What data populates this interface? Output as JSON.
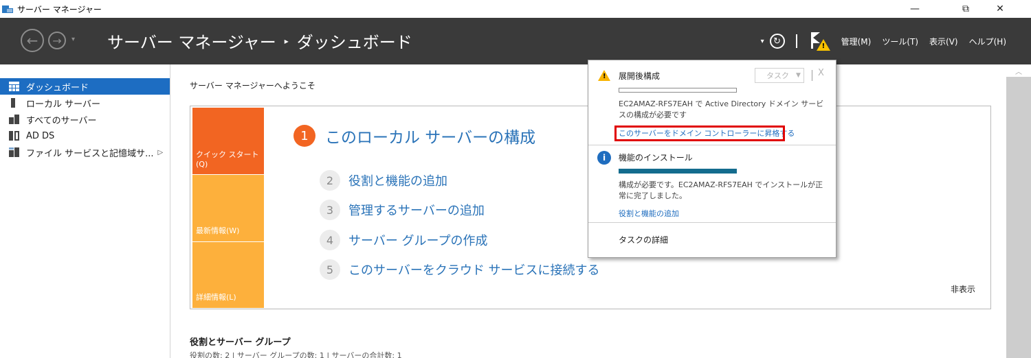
{
  "window": {
    "title": "サーバー マネージャー",
    "minimize": "—",
    "restore": "⧉",
    "close": "✕"
  },
  "header": {
    "back_icon": "←",
    "forward_icon": "→",
    "dropdown_icon": "▾",
    "breadcrumb_root": "サーバー マネージャー",
    "breadcrumb_sep": "▸",
    "breadcrumb_page": "ダッシュボード",
    "refresh_icon": "↻",
    "menus": [
      "管理(M)",
      "ツール(T)",
      "表示(V)",
      "ヘルプ(H)"
    ]
  },
  "sidebar": {
    "items": [
      {
        "label": "ダッシュボード",
        "icon": "dashboard-icon",
        "active": true
      },
      {
        "label": "ローカル サーバー",
        "icon": "server-icon",
        "active": false
      },
      {
        "label": "すべてのサーバー",
        "icon": "servers-icon",
        "active": false
      },
      {
        "label": "AD DS",
        "icon": "ad-ds-icon",
        "active": false
      },
      {
        "label": "ファイル サービスと記憶域サ...",
        "icon": "file-services-icon",
        "active": false,
        "expand": "▷"
      }
    ]
  },
  "main": {
    "welcome": "サーバー マネージャーへようこそ",
    "tabs": {
      "quick_start": "クイック スタート(Q)",
      "whats_new": "最新情報(W)",
      "learn_more": "詳細情報(L)"
    },
    "steps": [
      {
        "num": "1",
        "label": "このローカル サーバーの構成"
      },
      {
        "num": "2",
        "label": "役割と機能の追加"
      },
      {
        "num": "3",
        "label": "管理するサーバーの追加"
      },
      {
        "num": "4",
        "label": "サーバー グループの作成"
      },
      {
        "num": "5",
        "label": "このサーバーをクラウド サービスに接続する"
      }
    ],
    "hide": "非表示",
    "roles_title": "役割とサーバー グループ",
    "roles_summary": "役割の数: 2 | サーバー グループの数: 1 | サーバーの合計数: 1"
  },
  "notifications": {
    "post_deploy": {
      "title": "展開後構成",
      "task_dropdown": "タスク",
      "close": "X",
      "message": "EC2AMAZ-RFS7EAH で Active Directory ドメイン サービスの構成が必要です",
      "link": "このサーバーをドメイン コントローラーに昇格する"
    },
    "feature_install": {
      "title": "機能のインストール",
      "progress": 1.0,
      "message": "構成が必要です。EC2AMAZ-RFS7EAH でインストールが正常に完了しました。",
      "link": "役割と機能の追加"
    },
    "task_details": "タスクの詳細"
  },
  "colors": {
    "header_bg": "#3a3a3a",
    "active_nav": "#1d6dc2",
    "quick_start": "#f26522",
    "secondary_tab": "#fdb03c",
    "link": "#2a73b8",
    "highlight": "#e00000"
  }
}
